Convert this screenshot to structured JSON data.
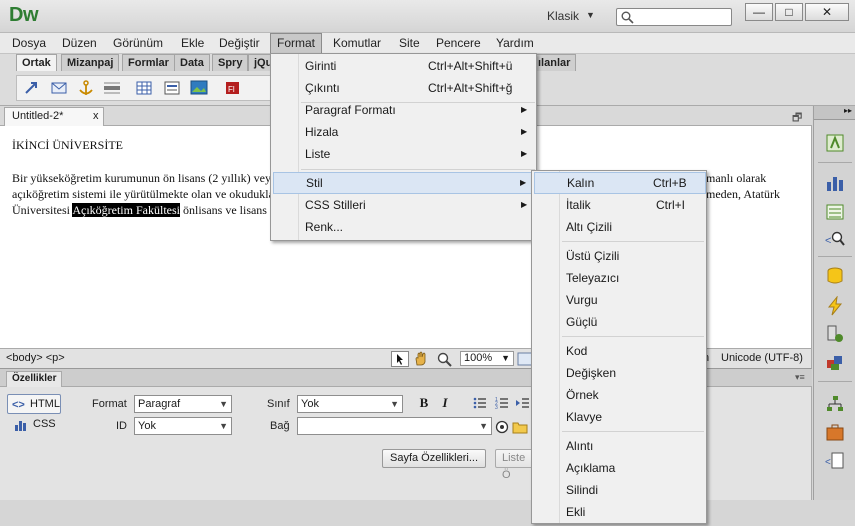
{
  "app": {
    "logo": "Dw",
    "workspace": "Klasik"
  },
  "window_controls": {
    "minimize": "—",
    "maximize": "□",
    "close": "✕"
  },
  "menubar": [
    "Dosya",
    "Düzen",
    "Görünüm",
    "Ekle",
    "Değiştir",
    "Format",
    "Komutlar",
    "Site",
    "Pencere",
    "Yardım"
  ],
  "insert_tabs": [
    "Ortak",
    "Mizanpaj",
    "Formlar",
    "Data",
    "Spry",
    "jQu",
    "ılanlar"
  ],
  "document": {
    "tab_label": "Untitled-2*",
    "tab_close": "x",
    "heading": "İKİNCİ ÜNİVERSİTE",
    "line1": "Bir yükseköğretim kurumunun ön lisans (2 yıllık) vey",
    "line1_right": "manlı olarak",
    "line2": "açıköğretim sistemi ile yürütülmekte olan ve okuduklar",
    "line2_right": "meden, Atatürk",
    "line3_start": "Üniversitesi ",
    "line3_highlight": "Açıköğretim Fakültesi",
    "line3_end": " önlisans ve lisans p"
  },
  "statusbar": {
    "tag_selector": "<body> <p>",
    "zoom": "100%",
    "encoding_prefix": "n",
    "encoding": "Unicode (UTF-8)"
  },
  "properties": {
    "title": "Özellikler",
    "html_button": "HTML",
    "css_button": "CSS",
    "format_label": "Format",
    "format_value": "Paragraf",
    "id_label": "ID",
    "id_value": "Yok",
    "class_label": "Sınıf",
    "class_value": "Yok",
    "link_label": "Bağ",
    "link_value": "",
    "bold": "B",
    "italic": "I",
    "page_props_button": "Sayfa Özellikleri...",
    "list_item_button": "Liste Ö"
  },
  "format_menu": {
    "items": [
      {
        "label": "Girinti",
        "shortcut": "Ctrl+Alt+Shift+ü",
        "submenu": false
      },
      {
        "label": "Çıkıntı",
        "shortcut": "Ctrl+Alt+Shift+ğ",
        "submenu": false
      },
      {
        "label": "Paragraf Formatı",
        "shortcut": "",
        "submenu": true
      },
      {
        "label": "Hizala",
        "shortcut": "",
        "submenu": true
      },
      {
        "label": "Liste",
        "shortcut": "",
        "submenu": true
      },
      {
        "label": "Stil",
        "shortcut": "",
        "submenu": true
      },
      {
        "label": "CSS Stilleri",
        "shortcut": "",
        "submenu": true
      },
      {
        "label": "Renk...",
        "shortcut": "",
        "submenu": false
      }
    ]
  },
  "style_menu": {
    "items": [
      {
        "label": "Kalın",
        "shortcut": "Ctrl+B"
      },
      {
        "label": "İtalik",
        "shortcut": "Ctrl+I"
      },
      {
        "label": "Altı Çizili",
        "shortcut": ""
      },
      {
        "label": "Üstü Çizili",
        "shortcut": ""
      },
      {
        "label": "Teleyazıcı",
        "shortcut": ""
      },
      {
        "label": "Vurgu",
        "shortcut": ""
      },
      {
        "label": "Güçlü",
        "shortcut": ""
      },
      {
        "label": "Kod",
        "shortcut": ""
      },
      {
        "label": "Değişken",
        "shortcut": ""
      },
      {
        "label": "Örnek",
        "shortcut": ""
      },
      {
        "label": "Klavye",
        "shortcut": ""
      },
      {
        "label": "Alıntı",
        "shortcut": ""
      },
      {
        "label": "Açıklama",
        "shortcut": ""
      },
      {
        "label": "Silindi",
        "shortcut": ""
      },
      {
        "label": "Ekli",
        "shortcut": ""
      }
    ]
  },
  "colors": {
    "menu_hover": "#dbe6f4",
    "logo_green": "#2e7d32",
    "highlight": "#000000"
  }
}
